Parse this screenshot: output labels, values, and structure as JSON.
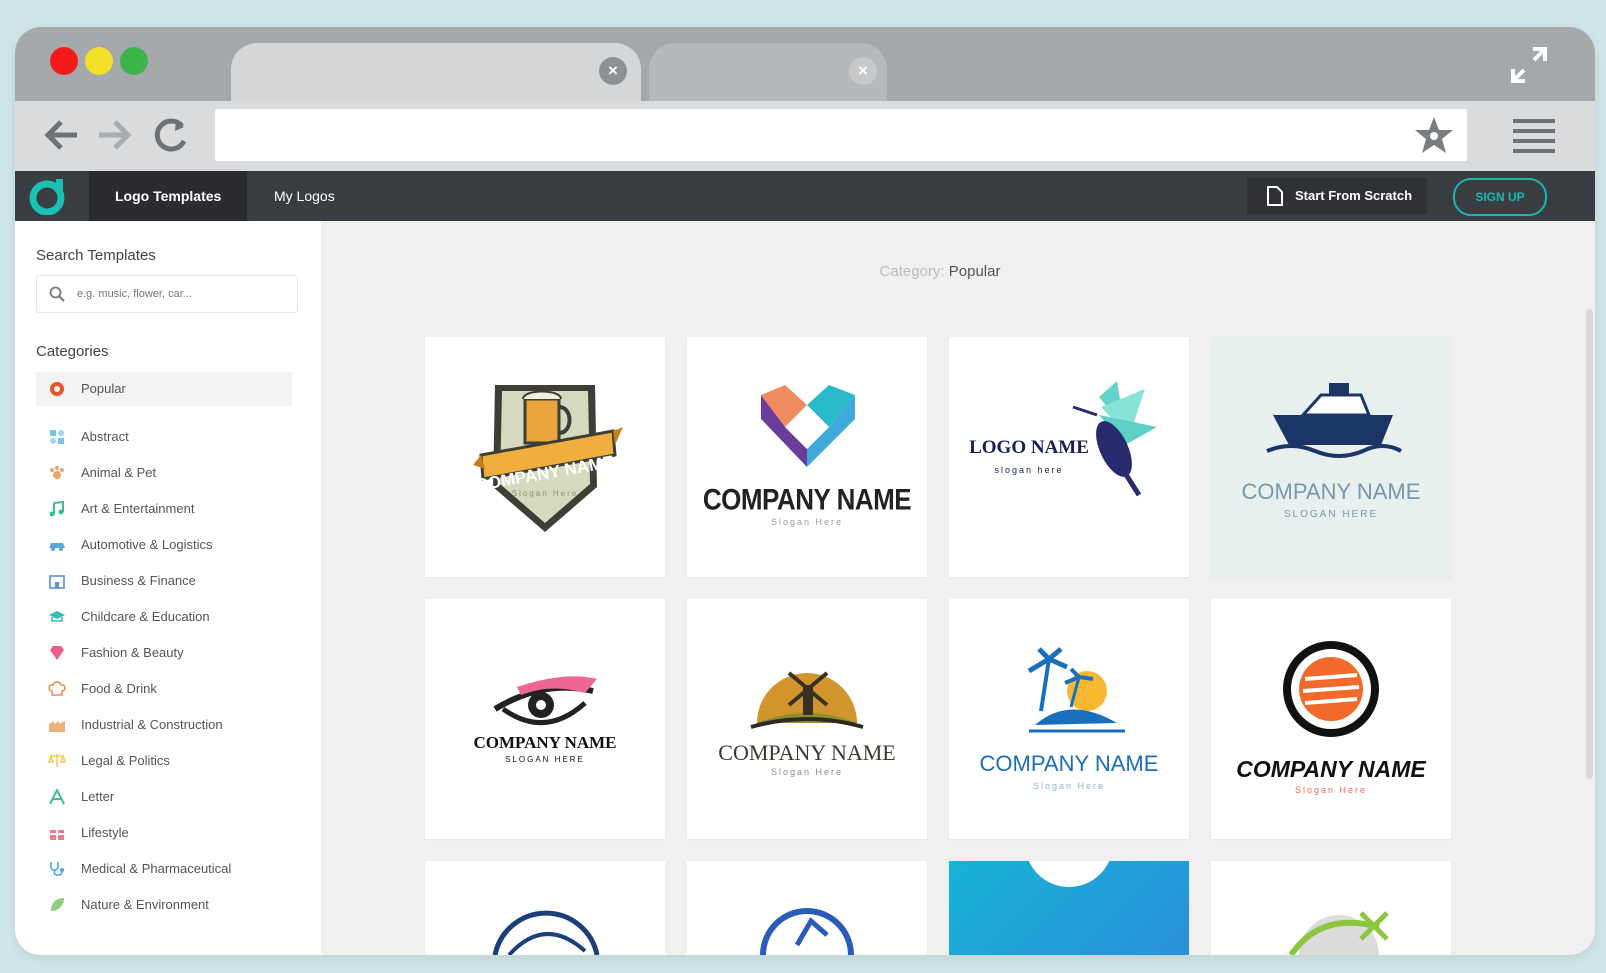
{
  "browser": {
    "traffic_lights": [
      "#f41a1c",
      "#f2df27",
      "#3bb54a"
    ],
    "url": ""
  },
  "appnav": {
    "tabs": [
      "Logo Templates",
      "My Logos"
    ],
    "start_from_scratch": "Start From Scratch",
    "sign_up": "SIGN UP"
  },
  "sidebar": {
    "search_title": "Search Templates",
    "search_placeholder": "e.g. music, flower, car...",
    "categories_title": "Categories",
    "categories": [
      {
        "label": "Popular",
        "icon": "popular-icon",
        "active": true
      },
      {
        "label": "Abstract",
        "icon": "abstract-icon"
      },
      {
        "label": "Animal & Pet",
        "icon": "paw-icon"
      },
      {
        "label": "Art & Entertainment",
        "icon": "music-note-icon"
      },
      {
        "label": "Automotive & Logistics",
        "icon": "car-icon"
      },
      {
        "label": "Business & Finance",
        "icon": "building-icon"
      },
      {
        "label": "Childcare & Education",
        "icon": "graduation-cap-icon"
      },
      {
        "label": "Fashion & Beauty",
        "icon": "diamond-icon"
      },
      {
        "label": "Food & Drink",
        "icon": "chef-hat-icon"
      },
      {
        "label": "Industrial & Construction",
        "icon": "factory-icon"
      },
      {
        "label": "Legal & Politics",
        "icon": "scales-icon"
      },
      {
        "label": "Letter",
        "icon": "letter-a-icon"
      },
      {
        "label": "Lifestyle",
        "icon": "gift-icon"
      },
      {
        "label": "Medical & Pharmaceutical",
        "icon": "stethoscope-icon"
      },
      {
        "label": "Nature & Environment",
        "icon": "leaf-icon"
      }
    ]
  },
  "main": {
    "category_prefix": "Category:",
    "category_value": "Popular",
    "templates": [
      {
        "name": "COMPANY NAME",
        "slogan": "Slogan Here",
        "icon": "beer-shield-logo-icon"
      },
      {
        "name": "COMPANY NAME",
        "slogan": "Slogan Here",
        "icon": "geometric-heart-logo-icon"
      },
      {
        "name": "LOGO NAME",
        "slogan": "slogan here",
        "icon": "hummingbird-logo-icon"
      },
      {
        "name": "COMPANY NAME",
        "slogan": "SLOGAN HERE",
        "icon": "cruise-ship-logo-icon"
      },
      {
        "name": "COMPANY NAME",
        "slogan": "SLOGAN HERE",
        "icon": "eye-lash-logo-icon"
      },
      {
        "name": "COMPANY NAME",
        "slogan": "Slogan Here",
        "icon": "windmill-farm-logo-icon"
      },
      {
        "name": "COMPANY NAME",
        "slogan": "Slogan Here",
        "icon": "palm-island-logo-icon"
      },
      {
        "name": "COMPANY NAME",
        "slogan": "Slogan Here",
        "icon": "sushi-roll-logo-icon"
      },
      {
        "name": "",
        "slogan": "",
        "icon": "circle-swoosh-logo-icon"
      },
      {
        "name": "",
        "slogan": "",
        "icon": "blue-circle-logo-icon"
      },
      {
        "name": "",
        "slogan": "",
        "icon": "dots-circle-logo-icon"
      },
      {
        "name": "",
        "slogan": "",
        "icon": "planet-logo-icon"
      }
    ]
  }
}
